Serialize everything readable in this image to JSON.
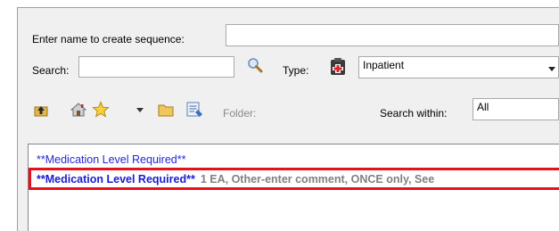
{
  "labels": {
    "enter_name": "Enter name to create sequence:",
    "search": "Search:",
    "type": "Type:",
    "folder": "Folder:",
    "search_within": "Search within:"
  },
  "fields": {
    "sequence_name": "",
    "search": "",
    "type_value": "Inpatient",
    "search_within_value": "All"
  },
  "results": {
    "row1": "**Medication Level Required**",
    "row2_name": "**Medication Level Required**",
    "row2_details": "1 EA, Other-enter comment, ONCE only, See"
  },
  "colors": {
    "highlight": "#e8101a",
    "link_blue": "#2626d9"
  },
  "icons": [
    "magnifier-icon",
    "order-type-icon",
    "up-folder-icon",
    "home-icon",
    "favorites-star-icon",
    "dropdown-arrow-icon",
    "folder-icon",
    "edit-list-icon"
  ]
}
